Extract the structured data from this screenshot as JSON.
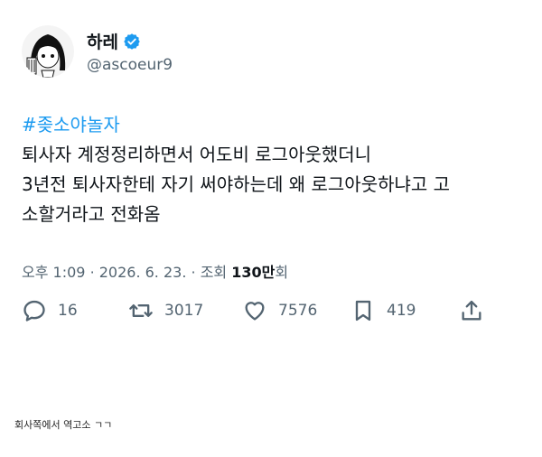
{
  "colors": {
    "link": "#1d9bf0",
    "text": "#0f1419",
    "muted": "#536471",
    "verified": "#1d9bf0"
  },
  "tweet": {
    "author": {
      "display_name": "하레",
      "handle": "@ascoeur9",
      "verified": true
    },
    "hashtag": "#좆소야놀자",
    "lines": [
      "퇴사자 계정정리하면서 어도비 로그아웃했더니",
      "3년전 퇴사자한테 자기 써야하는데 왜 로그아웃하냐고 고",
      "소할거라고 전화옴"
    ],
    "meta": {
      "time": "오후 1:09",
      "date": "2026. 6. 23.",
      "views_label": "조회",
      "views_number": "130만",
      "views_suffix": "회"
    },
    "actions": {
      "reply": {
        "icon": "reply-icon",
        "count": "16"
      },
      "retweet": {
        "icon": "retweet-icon",
        "count": "3017"
      },
      "like": {
        "icon": "heart-icon",
        "count": "7576"
      },
      "bookmark": {
        "icon": "bookmark-icon",
        "count": "419"
      },
      "share": {
        "icon": "share-icon"
      }
    }
  },
  "caption": "회사쪽에서 역고소 ㄱㄱ"
}
